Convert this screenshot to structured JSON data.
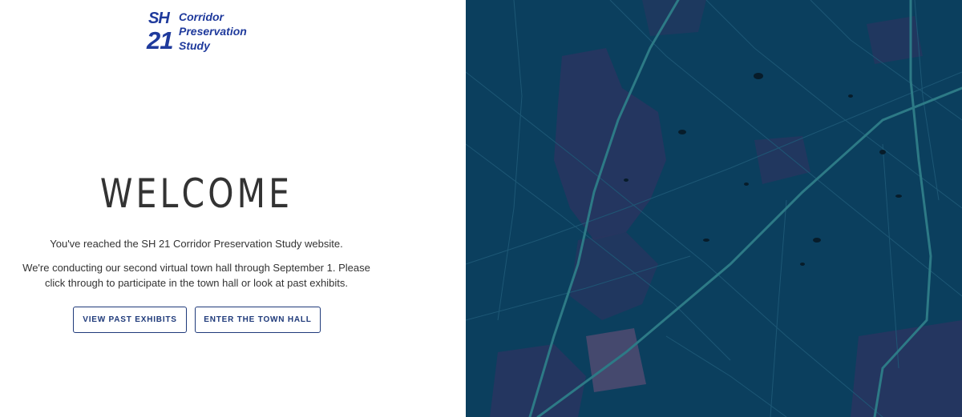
{
  "logo": {
    "sh": "SH",
    "num": "21",
    "line1": "Corridor",
    "line2": "Preservation",
    "line3": "Study"
  },
  "welcome": {
    "title": "WELCOME",
    "line1": "You've reached the SH 21 Corridor Preservation Study website.",
    "line2": "We're conducting our second virtual town hall through September 1. Please click through to participate in the town hall or look at past exhibits."
  },
  "buttons": {
    "past_label": "VIEW PAST EXHIBITS",
    "town_label": "ENTER THE TOWN HALL"
  },
  "colors": {
    "brand_blue": "#1f3a9c",
    "button_border": "#1f3a7a",
    "map_water": "#0b3f5e",
    "map_urban": "#2a3560",
    "map_road": "#2d7a86"
  }
}
